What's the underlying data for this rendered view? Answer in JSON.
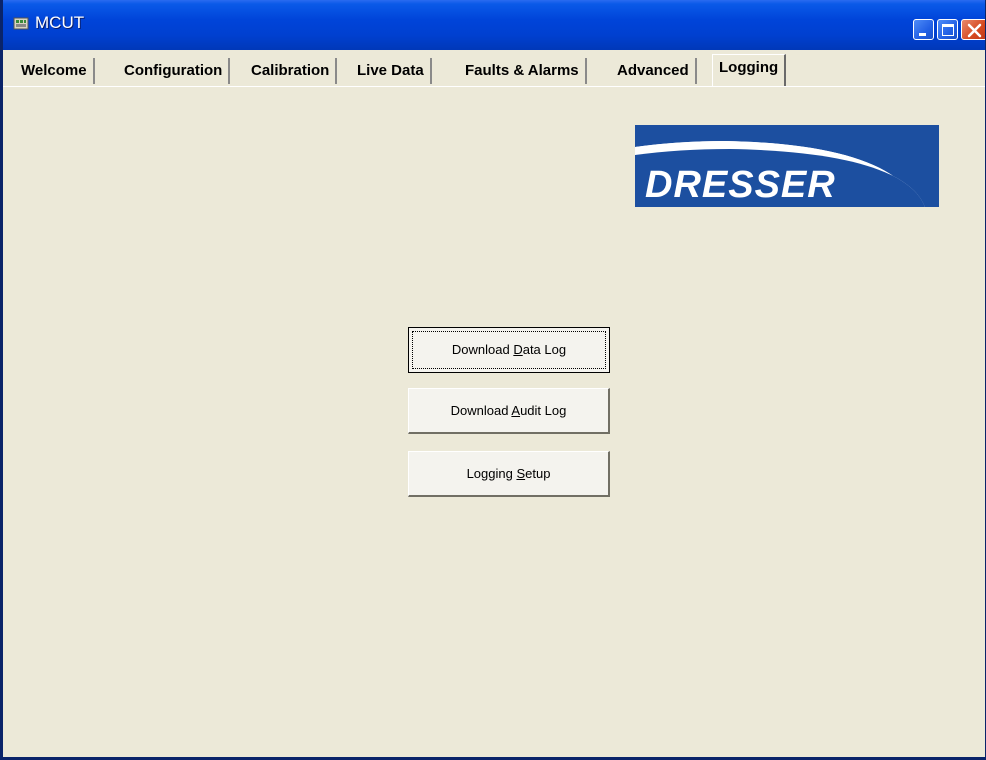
{
  "window": {
    "title": "MCUT",
    "icon": "app-icon"
  },
  "tabs": [
    {
      "label": "Welcome"
    },
    {
      "label": "Configuration"
    },
    {
      "label": "Calibration"
    },
    {
      "label": "Live Data"
    },
    {
      "label": "Faults & Alarms"
    },
    {
      "label": "Advanced"
    },
    {
      "label": "Logging",
      "active": true
    }
  ],
  "logo": {
    "text": "DRESSER",
    "colors": {
      "primary": "#1c4fa0",
      "swoosh": "#ffffff"
    }
  },
  "buttons": {
    "download_data_log": {
      "pre": "Download ",
      "mnemonic": "D",
      "post": "ata Log"
    },
    "download_audit_log": {
      "pre": "Download ",
      "mnemonic": "A",
      "post": "udit Log"
    },
    "logging_setup": {
      "pre": "Logging ",
      "mnemonic": "S",
      "post": "etup"
    }
  },
  "colors": {
    "titlebar": "#0044d9",
    "background": "#ece9d8"
  }
}
